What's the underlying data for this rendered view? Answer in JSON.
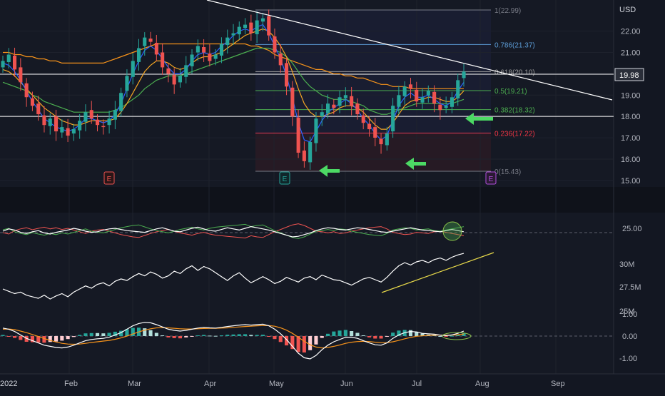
{
  "colors": {
    "background": "#131722",
    "grid": "#1e222d",
    "candle_up": "#26a69a",
    "candle_down": "#ef5350",
    "ma_fast": "#2962ff",
    "ma_mid": "#f5a623",
    "ma_slow": "#4caf50",
    "ma_long": "#f7931a",
    "trendline": "#ffffff",
    "volume_trend": "#e6d84a",
    "arrow": "#4cd964",
    "fib_line": "#787b86",
    "fib_786": "#5b9bd5",
    "fib_618": "#9c9c9c",
    "fib_5": "#4caf50",
    "fib_236": "#f23645"
  },
  "axis": {
    "currency": "USD",
    "price_ticks": [
      "22.00",
      "21.00",
      "20.00",
      "19.00",
      "18.00",
      "17.00",
      "16.00",
      "15.00"
    ],
    "current_price": "19.98",
    "rsi_tick": "25.00",
    "volume_ticks": [
      "30M",
      "27.5M",
      "25M"
    ],
    "macd_ticks": [
      "1.00",
      "0.00",
      "-1.00"
    ],
    "time_labels": [
      "2022",
      "Feb",
      "Mar",
      "Apr",
      "May",
      "Jun",
      "Jul",
      "Aug",
      "Sep"
    ]
  },
  "fib_levels": [
    {
      "label": "1(22.99)",
      "price": 22.99,
      "color": "#787b86"
    },
    {
      "label": "0.786(21.37)",
      "price": 21.37,
      "color": "#5b9bd5"
    },
    {
      "label": "0.618(20.10)",
      "price": 20.1,
      "color": "#9c9c9c"
    },
    {
      "label": "0.5(19.21)",
      "price": 19.21,
      "color": "#4caf50"
    },
    {
      "label": "0.382(18.32)",
      "price": 18.32,
      "color": "#4caf50"
    },
    {
      "label": "0.236(17.22)",
      "price": 17.22,
      "color": "#f23645"
    },
    {
      "label": "0(15.43)",
      "price": 15.43,
      "color": "#787b86"
    }
  ],
  "earnings_markers": [
    "E",
    "E",
    "E"
  ],
  "chart_data": {
    "type": "candlestick",
    "price_scale": [
      15,
      23
    ],
    "price_closes": [
      20.6,
      20.9,
      20.2,
      19.6,
      18.9,
      18.5,
      18.1,
      17.6,
      17.9,
      17.3,
      17.5,
      17.1,
      17.4,
      17.8,
      18.2,
      17.9,
      17.6,
      17.5,
      17.9,
      18.3,
      19.1,
      19.9,
      20.6,
      21.2,
      21.7,
      21.5,
      20.9,
      20.3,
      20.0,
      19.5,
      19.9,
      20.4,
      20.9,
      21.3,
      21.0,
      20.6,
      20.9,
      21.4,
      21.7,
      21.9,
      22.2,
      22.3,
      21.9,
      22.5,
      22.6,
      21.8,
      21.0,
      20.4,
      19.4,
      18.0,
      16.3,
      15.9,
      16.8,
      17.9,
      18.2,
      18.6,
      18.4,
      18.9,
      19.0,
      18.5,
      18.1,
      17.7,
      17.4,
      17.0,
      16.7,
      17.2,
      18.5,
      19.0,
      19.4,
      19.3,
      18.7,
      18.9,
      19.2,
      18.6,
      18.3,
      18.5,
      18.9,
      19.7,
      20.1
    ],
    "ma_fast": [
      20.5,
      20.4,
      20.1,
      19.7,
      19.2,
      18.7,
      18.3,
      17.9,
      17.7,
      17.5,
      17.4,
      17.3,
      17.4,
      17.6,
      17.9,
      17.9,
      17.8,
      17.7,
      17.8,
      18.1,
      18.6,
      19.3,
      20.0,
      20.6,
      21.1,
      21.3,
      21.1,
      20.7,
      20.3,
      20.0,
      20.0,
      20.2,
      20.6,
      20.9,
      21.0,
      20.9,
      21.0,
      21.3,
      21.5,
      21.8,
      22.0,
      22.1,
      22.0,
      22.2,
      22.3,
      21.9,
      21.3,
      20.7,
      19.9,
      18.9,
      17.7,
      16.9,
      16.8,
      17.3,
      17.8,
      18.2,
      18.4,
      18.6,
      18.8,
      18.6,
      18.3,
      17.9,
      17.6,
      17.2,
      16.9,
      17.1,
      17.8,
      18.5,
      18.9,
      19.1,
      18.9,
      18.9,
      19.0,
      18.8,
      18.6,
      18.5,
      18.7,
      19.2,
      19.6
    ],
    "ma_mid": [
      20.2,
      20.1,
      19.9,
      19.6,
      19.3,
      19.0,
      18.7,
      18.4,
      18.2,
      18.0,
      17.8,
      17.7,
      17.6,
      17.6,
      17.7,
      17.8,
      17.8,
      17.8,
      17.8,
      17.9,
      18.2,
      18.6,
      19.1,
      19.6,
      20.1,
      20.4,
      20.6,
      20.6,
      20.5,
      20.3,
      20.2,
      20.3,
      20.5,
      20.7,
      20.8,
      20.8,
      20.9,
      21.0,
      21.2,
      21.4,
      21.6,
      21.8,
      21.9,
      22.0,
      22.1,
      22.0,
      21.7,
      21.3,
      20.8,
      20.1,
      19.3,
      18.6,
      18.2,
      18.0,
      18.0,
      18.1,
      18.2,
      18.4,
      18.5,
      18.5,
      18.4,
      18.2,
      17.9,
      17.6,
      17.4,
      17.4,
      17.7,
      18.1,
      18.5,
      18.7,
      18.8,
      18.8,
      18.9,
      18.9,
      18.8,
      18.7,
      18.7,
      18.9,
      19.2
    ],
    "ma_slow": [
      19.6,
      19.5,
      19.4,
      19.3,
      19.2,
      19.0,
      18.9,
      18.7,
      18.6,
      18.5,
      18.4,
      18.3,
      18.2,
      18.2,
      18.2,
      18.2,
      18.2,
      18.2,
      18.2,
      18.3,
      18.4,
      18.6,
      18.8,
      19.0,
      19.3,
      19.5,
      19.7,
      19.8,
      19.9,
      19.9,
      19.9,
      20.0,
      20.1,
      20.2,
      20.3,
      20.4,
      20.5,
      20.6,
      20.7,
      20.8,
      20.9,
      21.0,
      21.1,
      21.2,
      21.2,
      21.2,
      21.1,
      21.0,
      20.8,
      20.5,
      20.1,
      19.7,
      19.4,
      19.2,
      19.0,
      18.9,
      18.8,
      18.8,
      18.8,
      18.7,
      18.6,
      18.5,
      18.3,
      18.2,
      18.1,
      18.1,
      18.2,
      18.3,
      18.4,
      18.5,
      18.6,
      18.6,
      18.6,
      18.6,
      18.6,
      18.6,
      18.6,
      18.7,
      18.8
    ],
    "ma_long": [
      21.0,
      21.0,
      20.9,
      20.9,
      20.8,
      20.8,
      20.7,
      20.7,
      20.6,
      20.6,
      20.5,
      20.5,
      20.5,
      20.5,
      20.5,
      20.5,
      20.5,
      20.5,
      20.6,
      20.7,
      20.8,
      20.9,
      21.0,
      21.1,
      21.2,
      21.3,
      21.4,
      21.4,
      21.4,
      21.4,
      21.4,
      21.4,
      21.4,
      21.4,
      21.4,
      21.4,
      21.4,
      21.4,
      21.4,
      21.4,
      21.4,
      21.4,
      21.3,
      21.3,
      21.2,
      21.1,
      20.9,
      20.8,
      20.7,
      20.6,
      20.5,
      20.4,
      20.3,
      20.2,
      20.2,
      20.1,
      20.0,
      20.0,
      19.9,
      19.9,
      19.8,
      19.8,
      19.7,
      19.6,
      19.5,
      19.5,
      19.4,
      19.4,
      19.4,
      19.3,
      19.3,
      19.3,
      19.3,
      19.3,
      19.3,
      19.3,
      19.3,
      19.3,
      19.3
    ],
    "volume_line": [
      26.8,
      26.5,
      26.2,
      26.4,
      26.0,
      25.8,
      25.6,
      26.0,
      25.5,
      25.9,
      26.2,
      25.8,
      26.4,
      26.8,
      27.2,
      26.9,
      27.4,
      27.6,
      27.2,
      27.8,
      28.1,
      27.9,
      28.4,
      28.8,
      28.5,
      29.0,
      28.7,
      28.2,
      28.5,
      29.1,
      28.8,
      29.4,
      29.8,
      29.2,
      29.7,
      29.4,
      28.9,
      28.4,
      27.9,
      28.5,
      28.9,
      28.2,
      27.6,
      28.0,
      28.4,
      28.0,
      27.5,
      27.8,
      28.3,
      28.0,
      27.7,
      28.2,
      28.4,
      28.0,
      28.6,
      28.3,
      28.0,
      27.9,
      27.6,
      27.3,
      27.7,
      28.1,
      28.3,
      28.0,
      27.7,
      28.3,
      29.1,
      29.8,
      30.2,
      29.9,
      30.3,
      30.5,
      30.2,
      30.6,
      30.8,
      30.5,
      30.9,
      31.2,
      31.4
    ],
    "volume_scale": [
      24.5,
      31.5
    ],
    "macd_line": [
      0.35,
      0.3,
      0.2,
      0.05,
      -0.1,
      -0.2,
      -0.3,
      -0.4,
      -0.45,
      -0.5,
      -0.52,
      -0.48,
      -0.4,
      -0.3,
      -0.2,
      -0.15,
      -0.12,
      -0.1,
      -0.05,
      0.05,
      0.15,
      0.3,
      0.45,
      0.55,
      0.6,
      0.58,
      0.5,
      0.4,
      0.3,
      0.25,
      0.22,
      0.25,
      0.3,
      0.35,
      0.38,
      0.36,
      0.35,
      0.38,
      0.42,
      0.45,
      0.48,
      0.5,
      0.48,
      0.5,
      0.52,
      0.45,
      0.3,
      0.1,
      -0.15,
      -0.45,
      -0.75,
      -0.95,
      -1.0,
      -0.85,
      -0.6,
      -0.4,
      -0.25,
      -0.15,
      -0.05,
      -0.05,
      -0.1,
      -0.2,
      -0.3,
      -0.38,
      -0.4,
      -0.3,
      -0.1,
      0.05,
      0.15,
      0.2,
      0.18,
      0.12,
      0.1,
      0.08,
      0.04,
      0.02,
      0.05,
      0.12,
      0.22
    ],
    "macd_signal": [
      0.3,
      0.31,
      0.28,
      0.22,
      0.15,
      0.07,
      -0.02,
      -0.11,
      -0.19,
      -0.26,
      -0.32,
      -0.35,
      -0.36,
      -0.35,
      -0.32,
      -0.28,
      -0.25,
      -0.22,
      -0.19,
      -0.14,
      -0.08,
      0.0,
      0.09,
      0.18,
      0.26,
      0.32,
      0.36,
      0.37,
      0.36,
      0.34,
      0.32,
      0.31,
      0.31,
      0.32,
      0.33,
      0.34,
      0.34,
      0.35,
      0.36,
      0.38,
      0.4,
      0.42,
      0.43,
      0.45,
      0.46,
      0.46,
      0.43,
      0.36,
      0.26,
      0.12,
      -0.05,
      -0.23,
      -0.38,
      -0.48,
      -0.52,
      -0.5,
      -0.45,
      -0.39,
      -0.32,
      -0.27,
      -0.24,
      -0.23,
      -0.24,
      -0.27,
      -0.29,
      -0.29,
      -0.25,
      -0.19,
      -0.12,
      -0.06,
      -0.01,
      0.01,
      0.03,
      0.04,
      0.04,
      0.04,
      0.04,
      0.06,
      0.09
    ],
    "rsi_a": [
      55,
      60,
      48,
      42,
      38,
      45,
      40,
      36,
      42,
      38,
      44,
      40,
      46,
      52,
      58,
      50,
      46,
      44,
      50,
      56,
      62,
      66,
      70,
      72,
      65,
      58,
      52,
      48,
      44,
      50,
      56,
      60,
      64,
      58,
      54,
      60,
      64,
      66,
      68,
      70,
      72,
      74,
      66,
      70,
      72,
      62,
      52,
      44,
      36,
      28,
      24,
      30,
      40,
      50,
      52,
      56,
      52,
      58,
      56,
      50,
      46,
      42,
      38,
      36,
      34,
      42,
      54,
      58,
      62,
      60,
      54,
      56,
      58,
      52,
      50,
      54,
      58,
      62,
      66
    ],
    "rsi_b": [
      45,
      40,
      52,
      58,
      62,
      55,
      60,
      64,
      58,
      62,
      56,
      60,
      54,
      48,
      42,
      50,
      54,
      56,
      50,
      44,
      38,
      34,
      30,
      28,
      35,
      42,
      48,
      52,
      56,
      50,
      44,
      40,
      36,
      42,
      46,
      40,
      36,
      34,
      32,
      30,
      28,
      26,
      34,
      30,
      28,
      38,
      48,
      56,
      64,
      72,
      76,
      70,
      60,
      50,
      48,
      44,
      48,
      42,
      44,
      50,
      54,
      58,
      62,
      64,
      66,
      58,
      46,
      42,
      38,
      40,
      46,
      44,
      42,
      48,
      50,
      46,
      42,
      38,
      34
    ],
    "rsi_c": [
      50,
      58,
      54,
      46,
      42,
      48,
      52,
      44,
      40,
      46,
      50,
      54,
      60,
      56,
      50,
      46,
      48,
      54,
      58,
      60,
      56,
      52,
      50,
      48,
      46,
      52,
      58,
      62,
      56,
      50,
      48,
      54,
      60,
      64,
      58,
      52,
      50,
      56,
      62,
      58,
      54,
      60,
      66,
      62,
      58,
      54,
      48,
      42,
      36,
      30,
      32,
      38,
      44,
      52,
      58,
      62,
      60,
      56,
      54,
      58,
      62,
      60,
      56,
      52,
      48,
      46,
      50,
      54,
      58,
      62,
      58,
      54,
      52,
      50,
      48,
      52,
      56,
      52,
      48
    ],
    "rsi_scale": [
      0,
      100
    ]
  }
}
